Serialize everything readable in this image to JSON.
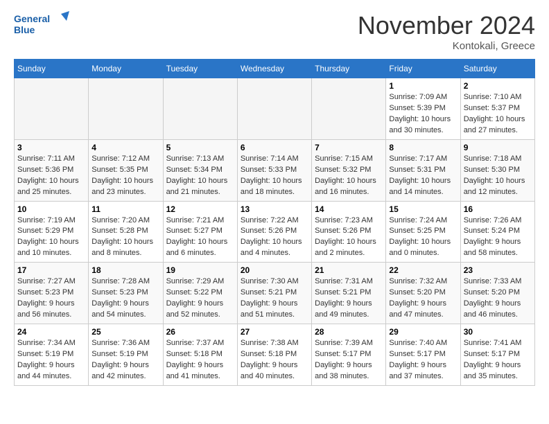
{
  "header": {
    "logo_line1": "General",
    "logo_line2": "Blue",
    "month": "November 2024",
    "location": "Kontokali, Greece"
  },
  "weekdays": [
    "Sunday",
    "Monday",
    "Tuesday",
    "Wednesday",
    "Thursday",
    "Friday",
    "Saturday"
  ],
  "weeks": [
    [
      {
        "day": "",
        "info": ""
      },
      {
        "day": "",
        "info": ""
      },
      {
        "day": "",
        "info": ""
      },
      {
        "day": "",
        "info": ""
      },
      {
        "day": "",
        "info": ""
      },
      {
        "day": "1",
        "info": "Sunrise: 7:09 AM\nSunset: 5:39 PM\nDaylight: 10 hours and 30 minutes."
      },
      {
        "day": "2",
        "info": "Sunrise: 7:10 AM\nSunset: 5:37 PM\nDaylight: 10 hours and 27 minutes."
      }
    ],
    [
      {
        "day": "3",
        "info": "Sunrise: 7:11 AM\nSunset: 5:36 PM\nDaylight: 10 hours and 25 minutes."
      },
      {
        "day": "4",
        "info": "Sunrise: 7:12 AM\nSunset: 5:35 PM\nDaylight: 10 hours and 23 minutes."
      },
      {
        "day": "5",
        "info": "Sunrise: 7:13 AM\nSunset: 5:34 PM\nDaylight: 10 hours and 21 minutes."
      },
      {
        "day": "6",
        "info": "Sunrise: 7:14 AM\nSunset: 5:33 PM\nDaylight: 10 hours and 18 minutes."
      },
      {
        "day": "7",
        "info": "Sunrise: 7:15 AM\nSunset: 5:32 PM\nDaylight: 10 hours and 16 minutes."
      },
      {
        "day": "8",
        "info": "Sunrise: 7:17 AM\nSunset: 5:31 PM\nDaylight: 10 hours and 14 minutes."
      },
      {
        "day": "9",
        "info": "Sunrise: 7:18 AM\nSunset: 5:30 PM\nDaylight: 10 hours and 12 minutes."
      }
    ],
    [
      {
        "day": "10",
        "info": "Sunrise: 7:19 AM\nSunset: 5:29 PM\nDaylight: 10 hours and 10 minutes."
      },
      {
        "day": "11",
        "info": "Sunrise: 7:20 AM\nSunset: 5:28 PM\nDaylight: 10 hours and 8 minutes."
      },
      {
        "day": "12",
        "info": "Sunrise: 7:21 AM\nSunset: 5:27 PM\nDaylight: 10 hours and 6 minutes."
      },
      {
        "day": "13",
        "info": "Sunrise: 7:22 AM\nSunset: 5:26 PM\nDaylight: 10 hours and 4 minutes."
      },
      {
        "day": "14",
        "info": "Sunrise: 7:23 AM\nSunset: 5:26 PM\nDaylight: 10 hours and 2 minutes."
      },
      {
        "day": "15",
        "info": "Sunrise: 7:24 AM\nSunset: 5:25 PM\nDaylight: 10 hours and 0 minutes."
      },
      {
        "day": "16",
        "info": "Sunrise: 7:26 AM\nSunset: 5:24 PM\nDaylight: 9 hours and 58 minutes."
      }
    ],
    [
      {
        "day": "17",
        "info": "Sunrise: 7:27 AM\nSunset: 5:23 PM\nDaylight: 9 hours and 56 minutes."
      },
      {
        "day": "18",
        "info": "Sunrise: 7:28 AM\nSunset: 5:23 PM\nDaylight: 9 hours and 54 minutes."
      },
      {
        "day": "19",
        "info": "Sunrise: 7:29 AM\nSunset: 5:22 PM\nDaylight: 9 hours and 52 minutes."
      },
      {
        "day": "20",
        "info": "Sunrise: 7:30 AM\nSunset: 5:21 PM\nDaylight: 9 hours and 51 minutes."
      },
      {
        "day": "21",
        "info": "Sunrise: 7:31 AM\nSunset: 5:21 PM\nDaylight: 9 hours and 49 minutes."
      },
      {
        "day": "22",
        "info": "Sunrise: 7:32 AM\nSunset: 5:20 PM\nDaylight: 9 hours and 47 minutes."
      },
      {
        "day": "23",
        "info": "Sunrise: 7:33 AM\nSunset: 5:20 PM\nDaylight: 9 hours and 46 minutes."
      }
    ],
    [
      {
        "day": "24",
        "info": "Sunrise: 7:34 AM\nSunset: 5:19 PM\nDaylight: 9 hours and 44 minutes."
      },
      {
        "day": "25",
        "info": "Sunrise: 7:36 AM\nSunset: 5:19 PM\nDaylight: 9 hours and 42 minutes."
      },
      {
        "day": "26",
        "info": "Sunrise: 7:37 AM\nSunset: 5:18 PM\nDaylight: 9 hours and 41 minutes."
      },
      {
        "day": "27",
        "info": "Sunrise: 7:38 AM\nSunset: 5:18 PM\nDaylight: 9 hours and 40 minutes."
      },
      {
        "day": "28",
        "info": "Sunrise: 7:39 AM\nSunset: 5:17 PM\nDaylight: 9 hours and 38 minutes."
      },
      {
        "day": "29",
        "info": "Sunrise: 7:40 AM\nSunset: 5:17 PM\nDaylight: 9 hours and 37 minutes."
      },
      {
        "day": "30",
        "info": "Sunrise: 7:41 AM\nSunset: 5:17 PM\nDaylight: 9 hours and 35 minutes."
      }
    ]
  ]
}
